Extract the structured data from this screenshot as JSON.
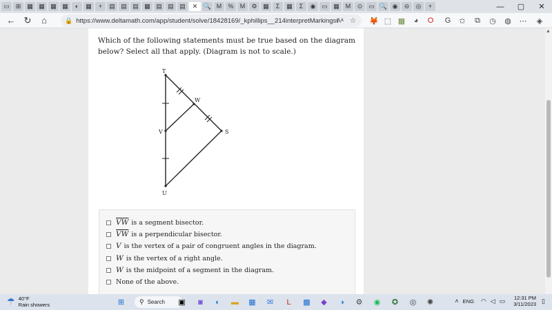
{
  "browser": {
    "url": "https://www.deltamath.com/app/student/solve/18428169/_kphillips__214interpretMarkingsOnDiagra...",
    "reader_label": "Aᴬ",
    "tab_icons": [
      "▭",
      "⊞",
      "▦",
      "▦",
      "▦",
      "▦",
      "◐",
      "▦",
      "+",
      "▤",
      "▤",
      "▤",
      "▦",
      "▤",
      "▤",
      "▤"
    ],
    "active_tab_close": "✕",
    "tab_icons_right": [
      "🔍",
      "M",
      "%",
      "M",
      "⚙",
      "▦",
      "Σ",
      "▦",
      "Σ",
      "◉",
      "▭",
      "▦",
      "M",
      "⊙",
      "▭",
      "🔍",
      "◉",
      "⊖",
      "◎",
      "+"
    ],
    "window_controls": {
      "minimize": "—",
      "maximize": "▢",
      "close": "✕"
    }
  },
  "question": {
    "text": "Which of the following statements must be true based on the diagram below? Select all that apply. (Diagram is not to scale.)"
  },
  "diagram": {
    "points": {
      "T": "T",
      "W": "W",
      "V": "V",
      "S": "S",
      "U": "U"
    }
  },
  "options": [
    {
      "var": "VW",
      "overline": true,
      "text": "is a segment bisector."
    },
    {
      "var": "VW",
      "overline": true,
      "text": "is a perpendicular bisector."
    },
    {
      "var": "V",
      "overline": false,
      "text": "is the vertex of a pair of congruent angles in the diagram."
    },
    {
      "var": "W",
      "overline": false,
      "text": "is the vertex of a right angle."
    },
    {
      "var": "W",
      "overline": false,
      "text": "is the midpoint of a segment in the diagram."
    },
    {
      "var": "",
      "overline": false,
      "text": "None of the above."
    }
  ],
  "taskbar": {
    "weather_temp": "40°F",
    "weather_desc": "Rain showers",
    "search_label": "Search",
    "language": "ENG",
    "time": "12:31 PM",
    "date": "3/11/2023"
  }
}
